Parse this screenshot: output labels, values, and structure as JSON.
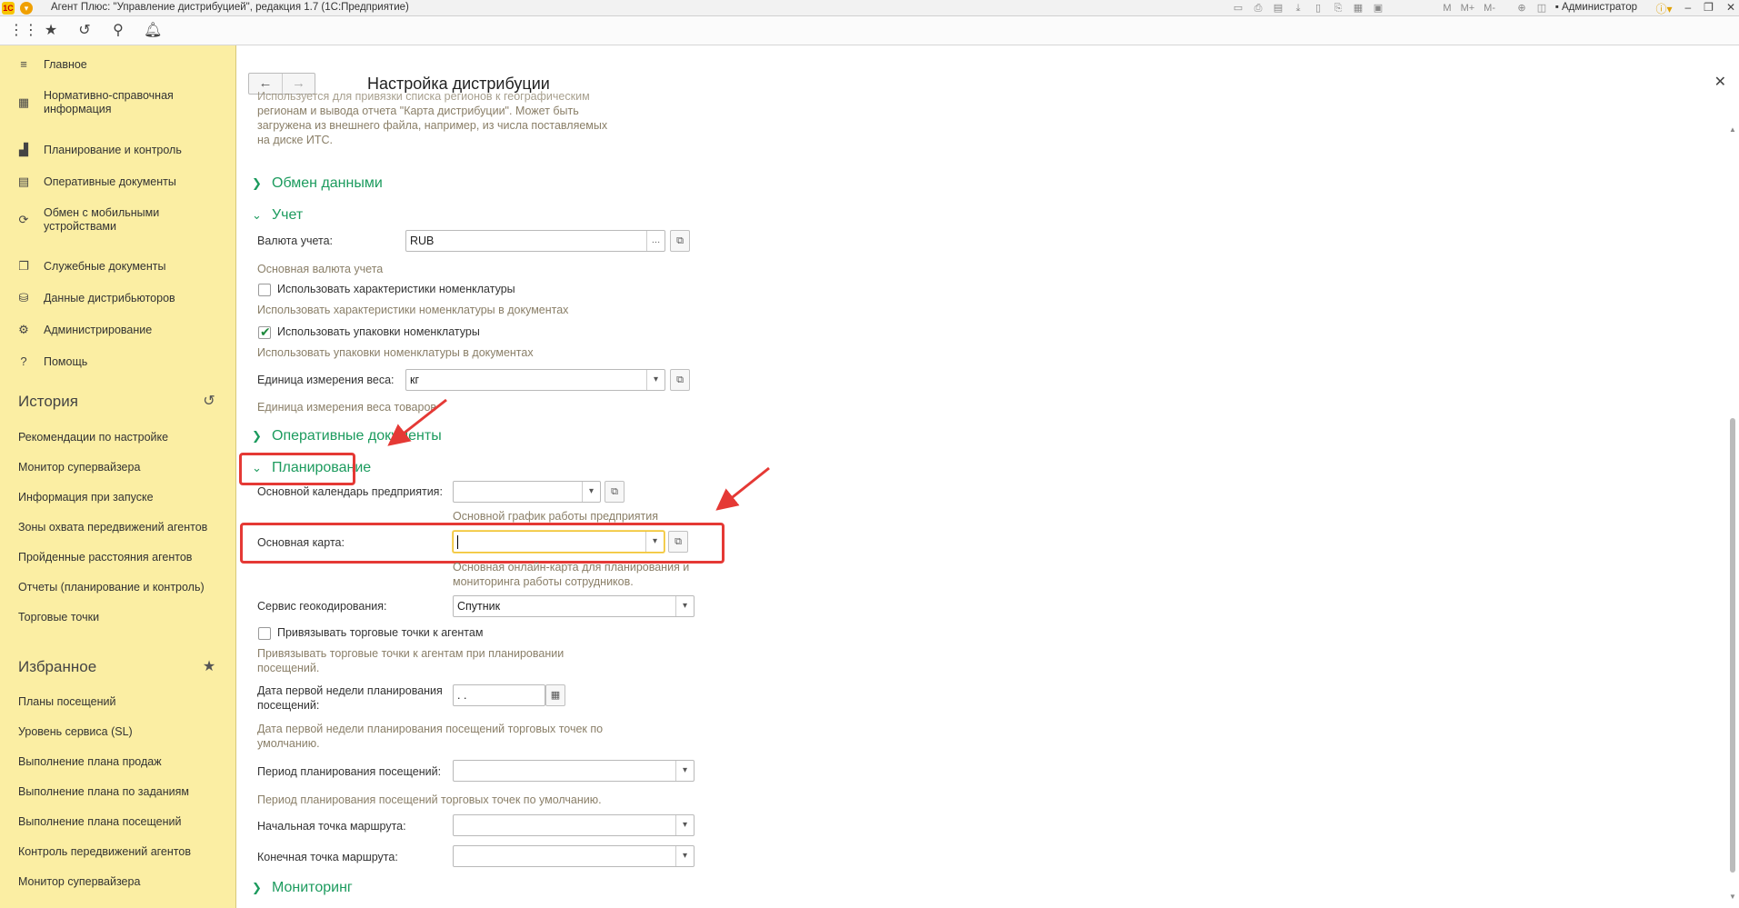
{
  "window": {
    "title": "Агент Плюс: \"Управление дистрибуцией\", редакция 1.7 (1С:Предприятие)",
    "user": "Администратор",
    "toolbar_m": [
      "M",
      "M+",
      "M-"
    ]
  },
  "sidebar": {
    "nav": [
      {
        "label": "Главное",
        "icon": "menu-icon"
      },
      {
        "label": "Нормативно-справочная информация",
        "icon": "grid-icon"
      },
      {
        "label": "Планирование и контроль",
        "icon": "chart-icon"
      },
      {
        "label": "Оперативные документы",
        "icon": "document-icon"
      },
      {
        "label": "Обмен с мобильными устройствами",
        "icon": "sync-icon"
      },
      {
        "label": "Служебные документы",
        "icon": "documents-icon"
      },
      {
        "label": "Данные дистрибьюторов",
        "icon": "data-icon"
      },
      {
        "label": "Администрирование",
        "icon": "gear-icon"
      },
      {
        "label": "Помощь",
        "icon": "help-icon"
      }
    ],
    "history": {
      "title": "История",
      "items": [
        "Рекомендации по настройке",
        "Монитор супервайзера",
        "Информация при запуске",
        "Зоны охвата передвижений агентов",
        "Пройденные расстояния агентов",
        "Отчеты (планирование и контроль)",
        "Торговые точки"
      ]
    },
    "favorites": {
      "title": "Избранное",
      "items": [
        "Планы посещений",
        "Уровень сервиса (SL)",
        "Выполнение плана продаж",
        "Выполнение плана по заданиям",
        "Выполнение плана посещений",
        "Контроль передвижений агентов",
        "Монитор супервайзера"
      ]
    }
  },
  "page": {
    "title": "Настройка дистрибуции",
    "top_hint": [
      "Используется для привязки списка регионов к географическим",
      "регионам и вывода отчета \"Карта дистрибуции\". Может быть",
      "загружена из внешнего файла, например, из числа поставляемых",
      "на диске ИТС."
    ],
    "groups": {
      "exchange": "Обмен данными",
      "accounting": "Учет",
      "operative": "Оперативные документы",
      "planning": "Планирование",
      "monitoring": "Мониторинг"
    },
    "accounting": {
      "currency_label": "Валюта учета:",
      "currency_value": "RUB",
      "currency_hint": "Основная валюта учета",
      "use_characteristics_label": "Использовать характеристики номенклатуры",
      "use_characteristics_checked": false,
      "use_characteristics_hint": "Использовать характеристики номенклатуры в документах",
      "use_packages_label": "Использовать упаковки номенклатуры",
      "use_packages_checked": true,
      "use_packages_hint": "Использовать упаковки номенклатуры в документах",
      "weight_unit_label": "Единица измерения веса:",
      "weight_unit_value": "кг",
      "weight_unit_hint": "Единица измерения веса товаров"
    },
    "planning": {
      "calendar_label": "Основной календарь предприятия:",
      "calendar_value": "",
      "calendar_hint": "Основной график работы предприятия",
      "map_label": "Основная карта:",
      "map_value": "",
      "map_hint": [
        "Основная онлайн-карта для планирования и",
        "мониторинга работы сотрудников."
      ],
      "geocoding_label": "Сервис геокодирования:",
      "geocoding_value": "Спутник",
      "bind_points_label": "Привязывать торговые точки к агентам",
      "bind_points_checked": false,
      "bind_points_hint": [
        "Привязывать торговые точки к агентам при планировании",
        "посещений."
      ],
      "first_week_label": [
        "Дата первой недели планирования",
        "посещений:"
      ],
      "first_week_value": " .  .",
      "first_week_hint": [
        "Дата первой недели планирования посещений торговых точек по",
        "умолчанию."
      ],
      "period_label": "Период планирования посещений:",
      "period_value": "",
      "period_hint": "Период планирования посещений торговых точек по умолчанию.",
      "route_start_label": "Начальная точка маршрута:",
      "route_start_value": "",
      "route_end_label": "Конечная точка маршрута:",
      "route_end_value": ""
    }
  },
  "colors": {
    "sidebar_bg": "#fbeea3",
    "group_green": "#1c9b5e",
    "annotation_red": "#e53935",
    "hint_text": "#8a7f68"
  }
}
